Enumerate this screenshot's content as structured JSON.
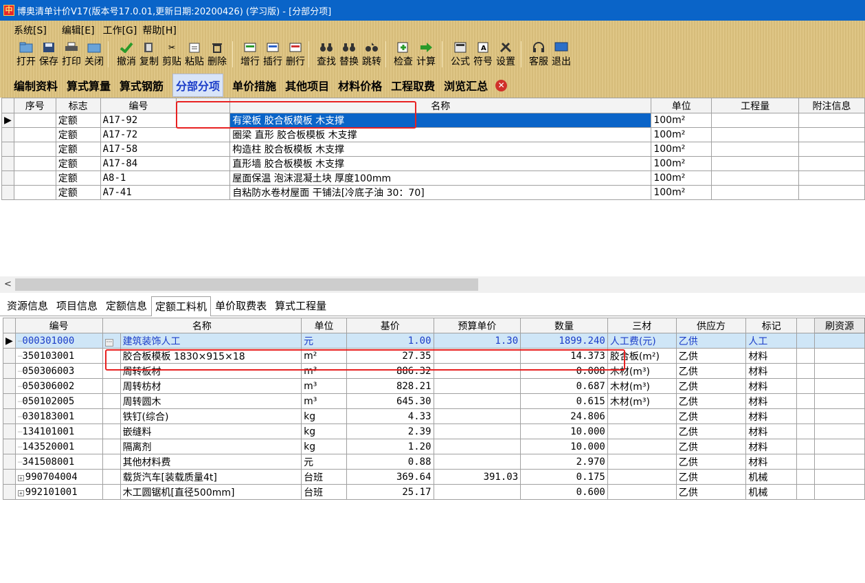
{
  "window": {
    "title": "博奥清单计价V17(版本号17.0.01,更新日期:20200426) (学习版) - [分部分项]",
    "icon": "中"
  },
  "menu": [
    "系统[S]",
    "编辑[E]",
    "工作[G]",
    "帮助[H]"
  ],
  "toolbar": [
    "打开",
    "保存",
    "打印",
    "关闭",
    "撤消",
    "复制",
    "剪贴",
    "粘贴",
    "删除",
    "增行",
    "插行",
    "删行",
    "查找",
    "替换",
    "跳转",
    "检查",
    "计算",
    "公式",
    "符号",
    "设置",
    "客服",
    "退出"
  ],
  "main_tabs": [
    "编制资料",
    "算式算量",
    "算式钢筋",
    "分部分项",
    "单价措施",
    "其他项目",
    "材料价格",
    "工程取费",
    "浏览汇总"
  ],
  "active_main_tab": "分部分项",
  "grid1": {
    "headers": [
      "序号",
      "标志",
      "编号",
      "",
      "名称",
      "单位",
      "工程量",
      "附注信息"
    ],
    "rows": [
      {
        "flag": "定额",
        "code": "A17-92",
        "name": "有梁板 胶合板模板 木支撑",
        "unit": "100m²"
      },
      {
        "flag": "定额",
        "code": "A17-72",
        "name": "圈梁 直形 胶合板模板 木支撑",
        "unit": "100m²"
      },
      {
        "flag": "定额",
        "code": "A17-58",
        "name": "构造柱 胶合板模板 木支撑",
        "unit": "100m²"
      },
      {
        "flag": "定额",
        "code": "A17-84",
        "name": "直形墙 胶合板模板 木支撑",
        "unit": "100m²"
      },
      {
        "flag": "定额",
        "code": "A8-1",
        "name": "屋面保温 泡沫混凝土块 厚度100mm",
        "unit": "100m²"
      },
      {
        "flag": "定额",
        "code": "A7-41",
        "name": "自粘防水卷材屋面 干铺法[冷底子油 30：70]",
        "unit": "100m²"
      }
    ]
  },
  "lower_tabs": [
    "资源信息",
    "项目信息",
    "定额信息",
    "定额工料机",
    "单价取费表",
    "算式工程量"
  ],
  "active_lower_tab": "定额工料机",
  "grid2": {
    "headers": [
      "编号",
      "名称",
      "单位",
      "基价",
      "预算单价",
      "数量",
      "三材",
      "供应方",
      "标记"
    ],
    "refresh_button": "刷资源",
    "rows": [
      {
        "code": "000301000",
        "name": "建筑装饰人工",
        "unit": "元",
        "base": "1.00",
        "budget": "1.30",
        "qty": "1899.240",
        "mat": "人工费(元)",
        "supplier": "乙供",
        "mark": "人工"
      },
      {
        "code": "350103001",
        "name": "胶合板模板 1830×915×18",
        "unit": "m²",
        "base": "27.35",
        "budget": "",
        "qty": "14.373",
        "mat": "胶合板(m²)",
        "supplier": "乙供",
        "mark": "材料"
      },
      {
        "code": "050306003",
        "name": "周转板材",
        "unit": "m³",
        "base": "886.32",
        "budget": "",
        "qty": "0.008",
        "mat": "木材(m³)",
        "supplier": "乙供",
        "mark": "材料"
      },
      {
        "code": "050306002",
        "name": "周转枋材",
        "unit": "m³",
        "base": "828.21",
        "budget": "",
        "qty": "0.687",
        "mat": "木材(m³)",
        "supplier": "乙供",
        "mark": "材料"
      },
      {
        "code": "050102005",
        "name": "周转圆木",
        "unit": "m³",
        "base": "645.30",
        "budget": "",
        "qty": "0.615",
        "mat": "木材(m³)",
        "supplier": "乙供",
        "mark": "材料"
      },
      {
        "code": "030183001",
        "name": "铁钉(综合)",
        "unit": "kg",
        "base": "4.33",
        "budget": "",
        "qty": "24.806",
        "mat": "",
        "supplier": "乙供",
        "mark": "材料"
      },
      {
        "code": "134101001",
        "name": "嵌缝料",
        "unit": "kg",
        "base": "2.39",
        "budget": "",
        "qty": "10.000",
        "mat": "",
        "supplier": "乙供",
        "mark": "材料"
      },
      {
        "code": "143520001",
        "name": "隔离剂",
        "unit": "kg",
        "base": "1.20",
        "budget": "",
        "qty": "10.000",
        "mat": "",
        "supplier": "乙供",
        "mark": "材料"
      },
      {
        "code": "341508001",
        "name": "其他材料费",
        "unit": "元",
        "base": "0.88",
        "budget": "",
        "qty": "2.970",
        "mat": "",
        "supplier": "乙供",
        "mark": "材料"
      },
      {
        "code": "990704004",
        "name": "载货汽车[装载质量4t]",
        "unit": "台班",
        "base": "369.64",
        "budget": "391.03",
        "qty": "0.175",
        "mat": "",
        "supplier": "乙供",
        "mark": "机械"
      },
      {
        "code": "992101001",
        "name": "木工圆锯机[直径500mm]",
        "unit": "台班",
        "base": "25.17",
        "budget": "",
        "qty": "0.600",
        "mat": "",
        "supplier": "乙供",
        "mark": "机械"
      }
    ]
  },
  "colors": {
    "titlebar": "#0a64c8",
    "toolbar_bg": "#ddc27e",
    "selection": "#0a64c8",
    "annotation": "#e82020"
  }
}
